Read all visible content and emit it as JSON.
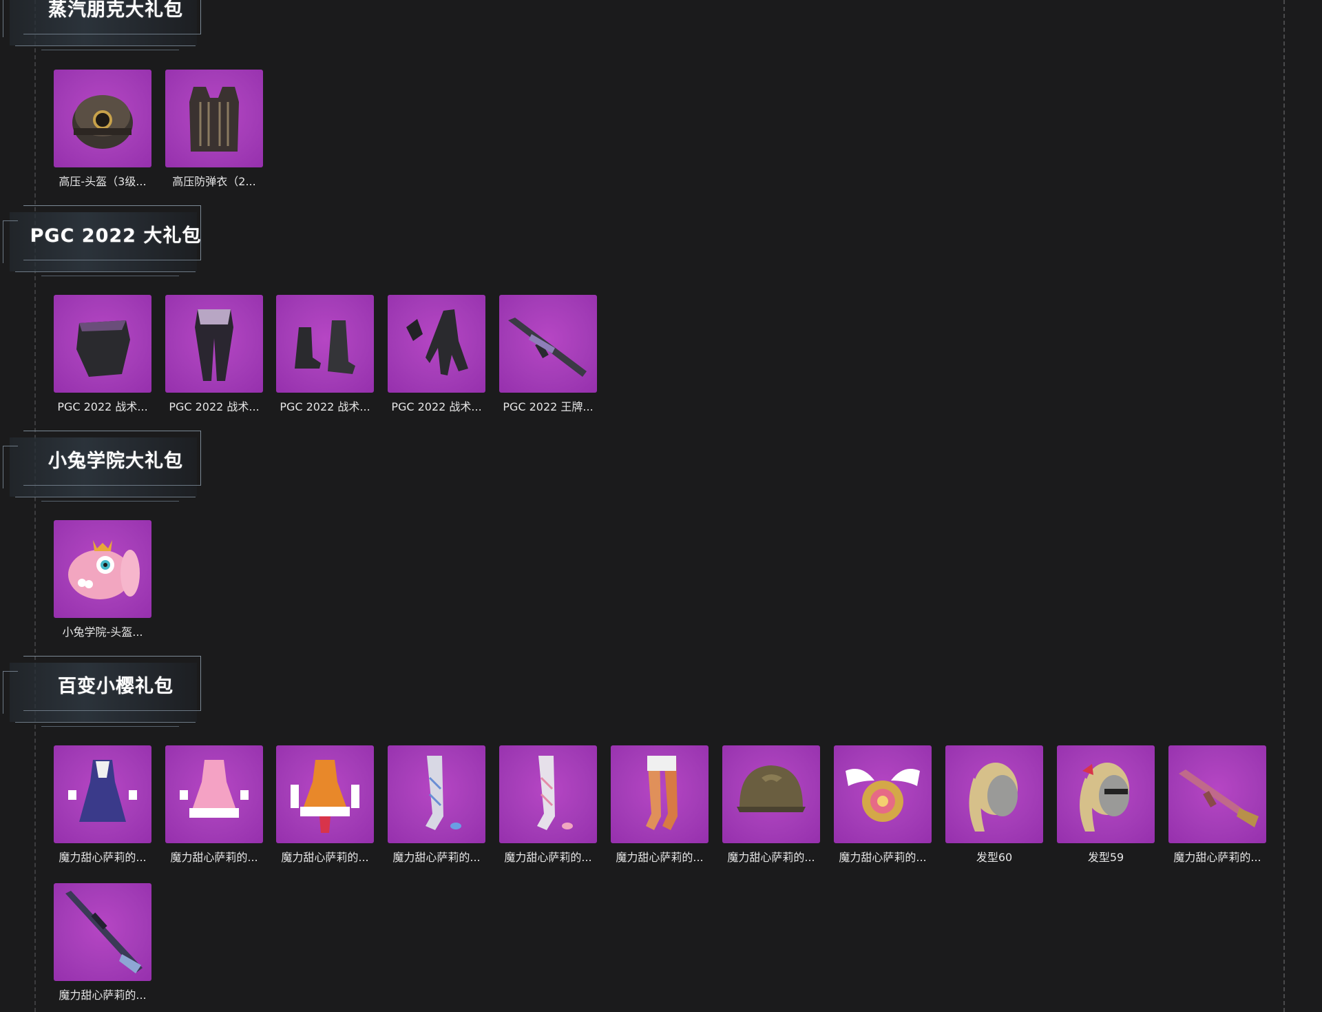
{
  "sections": [
    {
      "title": "蒸汽朋克大礼包",
      "items": [
        {
          "label": "高压-头盔（3级...",
          "icon": "helmet-icon"
        },
        {
          "label": "高压防弹衣（2...",
          "icon": "vest-icon"
        }
      ]
    },
    {
      "title": "PGC 2022 大礼包",
      "items": [
        {
          "label": "PGC 2022 战术...",
          "icon": "mask-icon"
        },
        {
          "label": "PGC 2022 战术...",
          "icon": "pants-icon"
        },
        {
          "label": "PGC 2022 战术...",
          "icon": "boots-icon"
        },
        {
          "label": "PGC 2022 战术...",
          "icon": "gloves-icon"
        },
        {
          "label": "PGC 2022 王牌...",
          "icon": "rifle-icon"
        }
      ]
    },
    {
      "title": "小兔学院大礼包",
      "items": [
        {
          "label": "小兔学院-头盔...",
          "icon": "bunny-helmet-icon"
        }
      ]
    },
    {
      "title": "百变小樱礼包",
      "items": [
        {
          "label": "魔力甜心萨莉的...",
          "icon": "dress-icon"
        },
        {
          "label": "魔力甜心萨莉的...",
          "icon": "dress-icon"
        },
        {
          "label": "魔力甜心萨莉的...",
          "icon": "dress-icon"
        },
        {
          "label": "魔力甜心萨莉的...",
          "icon": "stockings-icon"
        },
        {
          "label": "魔力甜心萨莉的...",
          "icon": "stockings-icon"
        },
        {
          "label": "魔力甜心萨莉的...",
          "icon": "stockings-icon"
        },
        {
          "label": "魔力甜心萨莉的...",
          "icon": "helmet-icon"
        },
        {
          "label": "魔力甜心萨莉的...",
          "icon": "winged-backpack-icon"
        },
        {
          "label": "发型60",
          "icon": "hairstyle-icon"
        },
        {
          "label": "发型59",
          "icon": "hairstyle-icon"
        },
        {
          "label": "魔力甜心萨莉的...",
          "icon": "rifle-icon"
        },
        {
          "label": "魔力甜心萨莉的...",
          "icon": "sniper-rifle-icon"
        }
      ]
    }
  ],
  "colors": {
    "background": "#1b1b1c",
    "tile": "#a33db7",
    "text": "#e6e6e6"
  }
}
